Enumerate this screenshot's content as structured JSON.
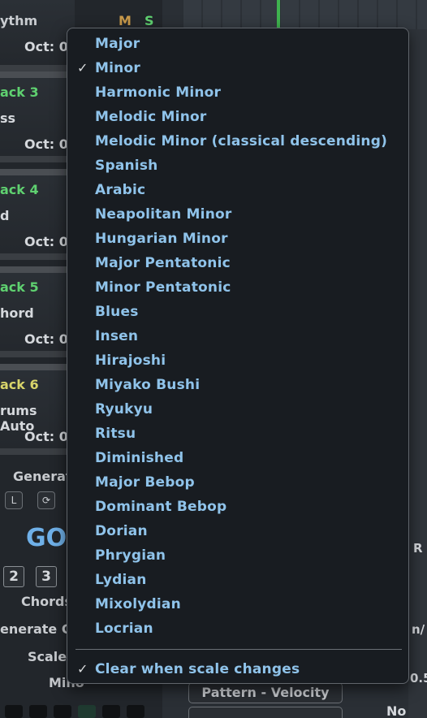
{
  "background": {
    "tracks": [
      {
        "name": "ythm",
        "oct": "Oct: 0",
        "name_color": "#c9ccd0"
      },
      {
        "name": "ack 3",
        "sub": "ss",
        "oct": "Oct: 0",
        "name_color": "#5fd170"
      },
      {
        "name": "ack 4",
        "sub": "d",
        "oct": "Oct: 0",
        "name_color": "#5fd170"
      },
      {
        "name": "ack 5",
        "sub": "hord",
        "oct": "Oct: 0",
        "name_color": "#5fd170"
      },
      {
        "name": "ack 6",
        "sub": "rums Auto",
        "oct": "Oct: 0",
        "name_color": "#d8d46a"
      }
    ],
    "mute_label": "M",
    "solo_label": "S",
    "generate_label": "Generat",
    "lock_label": "L",
    "go_label": "GO",
    "num_buttons": [
      "2",
      "3"
    ],
    "chords_label": "Chords",
    "generate_ch_label": "enerate Cl",
    "scale_label": "Scale",
    "scale_value": "Mino",
    "pattern_velocity_label": "Pattern - Velocity",
    "no_label": "No",
    "right_r_label": "R",
    "right_n_label": "n/",
    "right_05_label": "0.5"
  },
  "menu": {
    "items": [
      {
        "label": "Major",
        "checked": false
      },
      {
        "label": "Minor",
        "checked": true
      },
      {
        "label": "Harmonic Minor",
        "checked": false
      },
      {
        "label": "Melodic Minor",
        "checked": false
      },
      {
        "label": "Melodic Minor (classical descending)",
        "checked": false
      },
      {
        "label": "Spanish",
        "checked": false
      },
      {
        "label": "Arabic",
        "checked": false
      },
      {
        "label": "Neapolitan Minor",
        "checked": false
      },
      {
        "label": "Hungarian Minor",
        "checked": false
      },
      {
        "label": "Major Pentatonic",
        "checked": false
      },
      {
        "label": "Minor Pentatonic",
        "checked": false
      },
      {
        "label": "Blues",
        "checked": false
      },
      {
        "label": "Insen",
        "checked": false
      },
      {
        "label": "Hirajoshi",
        "checked": false
      },
      {
        "label": "Miyako Bushi",
        "checked": false
      },
      {
        "label": "Ryukyu",
        "checked": false
      },
      {
        "label": "Ritsu",
        "checked": false
      },
      {
        "label": "Diminished",
        "checked": false
      },
      {
        "label": "Major Bebop",
        "checked": false
      },
      {
        "label": "Dominant Bebop",
        "checked": false
      },
      {
        "label": "Dorian",
        "checked": false
      },
      {
        "label": "Phrygian",
        "checked": false
      },
      {
        "label": "Lydian",
        "checked": false
      },
      {
        "label": "Mixolydian",
        "checked": false
      },
      {
        "label": "Locrian",
        "checked": false
      }
    ],
    "option_clear": {
      "label": "Clear when scale changes",
      "checked": true
    },
    "check_glyph": "✓",
    "colors": {
      "item_text": "#8fc3ea",
      "check": "#d8dadc",
      "background": "#181c21"
    }
  }
}
